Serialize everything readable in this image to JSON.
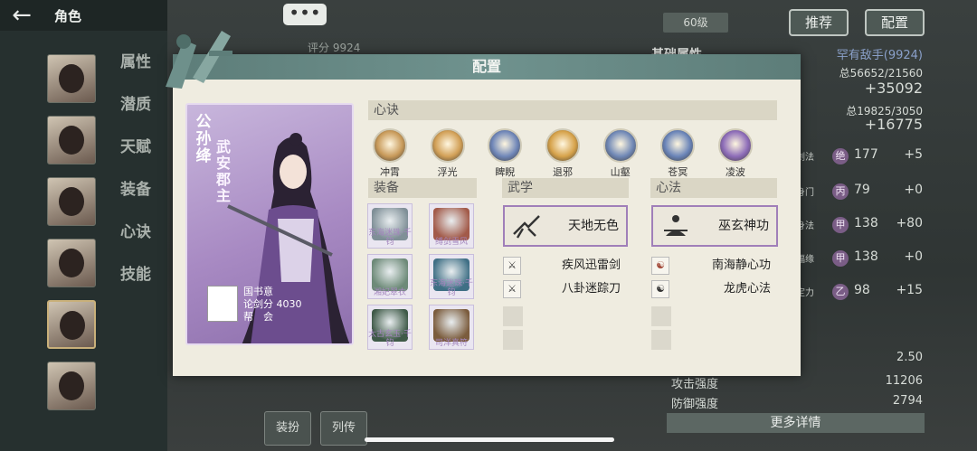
{
  "nav": {
    "back_icon": "back-arrow-icon",
    "title": "角色"
  },
  "side_menu": [
    "属性",
    "潜质",
    "天赋",
    "装备",
    "心诀",
    "技能"
  ],
  "top": {
    "chat_label": "•••",
    "level": "60级",
    "recommend_label": "推荐",
    "config_label": "配置",
    "score": "评分 9924"
  },
  "right_panel": {
    "section_title": "基础属性",
    "rank_label": "罕有敌手(9924)",
    "total1": "总56652/21560",
    "bonus1": "+35092",
    "total2": "总19825/3050",
    "bonus2": "+16775",
    "stats": [
      {
        "label": "剑法",
        "badge": "绝",
        "value": "177",
        "bonus": "+5"
      },
      {
        "label": "身门",
        "badge": "丙",
        "value": "79",
        "bonus": "+0"
      },
      {
        "label": "身法",
        "badge": "甲",
        "value": "138",
        "bonus": "+80"
      },
      {
        "label": "福缘",
        "badge": "甲",
        "value": "138",
        "bonus": "+0"
      },
      {
        "label": "定力",
        "badge": "乙",
        "value": "98",
        "bonus": "+15"
      }
    ],
    "bottom_stats": [
      {
        "label": "",
        "value": "2.50"
      },
      {
        "label": "攻击强度",
        "value": "11206"
      },
      {
        "label": "防御强度",
        "value": "2794"
      }
    ],
    "more_label": "更多详情"
  },
  "bottom_bar": [
    "装扮",
    "列传"
  ],
  "modal": {
    "title": "配置",
    "character": {
      "name": "公孙绛",
      "title": "武安郡主",
      "realm_label": "国书意",
      "score_label": "论剑分",
      "score_value": "4030",
      "guild_label": "帮　会"
    },
    "xinjue": {
      "label": "心诀",
      "items": [
        {
          "name": "冲霄",
          "color": "#c89a5a"
        },
        {
          "name": "浮光",
          "color": "#d2a057"
        },
        {
          "name": "睥睨",
          "color": "#6f86b8"
        },
        {
          "name": "退邪",
          "color": "#d6a24a"
        },
        {
          "name": "山壑",
          "color": "#7088b6"
        },
        {
          "name": "苍冥",
          "color": "#6a84b8"
        },
        {
          "name": "凌波",
          "color": "#8d6cb8"
        }
      ]
    },
    "equipment": {
      "label": "装备",
      "items": [
        {
          "name": "东海迷珠·千钧",
          "color": "#7f8f97"
        },
        {
          "name": "缚剑雪风",
          "color": "#a25a49"
        },
        {
          "name": "湘妃翠衣",
          "color": "#6d8a78"
        },
        {
          "name": "东海迷珠·千钧",
          "color": "#3f6f85"
        },
        {
          "name": "太古玄玉·千钧",
          "color": "#3f5a48"
        },
        {
          "name": "司洋真符",
          "color": "#7b5c3d"
        }
      ]
    },
    "wuxue": {
      "label": "武学",
      "main": "天地无色",
      "others": [
        "疾风迅雷剑",
        "八卦迷踪刀"
      ]
    },
    "xinfa": {
      "label": "心法",
      "main": "巫玄神功",
      "others": [
        "南海静心功",
        "龙虎心法"
      ]
    }
  }
}
